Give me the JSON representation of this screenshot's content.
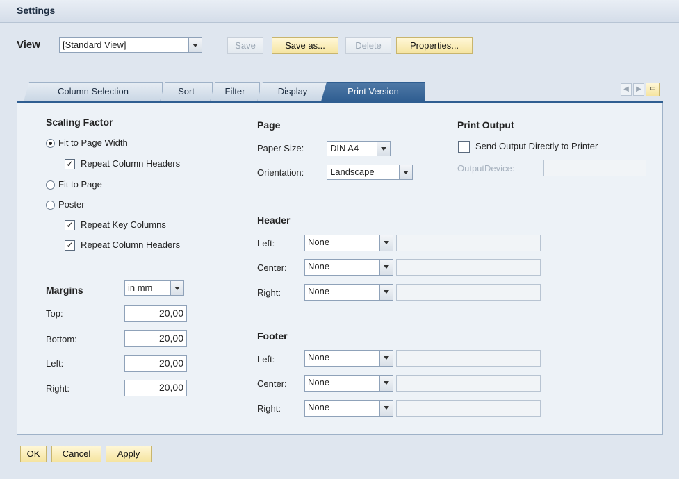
{
  "window": {
    "title": "Settings"
  },
  "view": {
    "label": "View",
    "selected": "[Standard View]",
    "buttons": {
      "save": "Save",
      "save_as": "Save as...",
      "delete": "Delete",
      "properties": "Properties..."
    }
  },
  "tabs": [
    "Column Selection",
    "Sort",
    "Filter",
    "Display",
    "Print Version"
  ],
  "active_tab": "Print Version",
  "scaling": {
    "title": "Scaling Factor",
    "fit_width": "Fit to Page Width",
    "repeat_col_headers_1": "Repeat Column Headers",
    "fit_page": "Fit to Page",
    "poster": "Poster",
    "repeat_key_cols": "Repeat Key Columns",
    "repeat_col_headers_2": "Repeat Column Headers"
  },
  "margins": {
    "title": "Margins",
    "unit": "in mm",
    "top_label": "Top:",
    "top": "20,00",
    "bottom_label": "Bottom:",
    "bottom": "20,00",
    "left_label": "Left:",
    "left": "20,00",
    "right_label": "Right:",
    "right": "20,00"
  },
  "page": {
    "title": "Page",
    "paper_label": "Paper Size:",
    "paper": "DIN A4",
    "orientation_label": "Orientation:",
    "orientation": "Landscape"
  },
  "print_output": {
    "title": "Print Output",
    "send_direct": "Send Output Directly to Printer",
    "device_label": "OutputDevice:"
  },
  "header": {
    "title": "Header",
    "left_label": "Left:",
    "left": "None",
    "center_label": "Center:",
    "center": "None",
    "right_label": "Right:",
    "right": "None"
  },
  "footer": {
    "title": "Footer",
    "left_label": "Left:",
    "left": "None",
    "center_label": "Center:",
    "center": "None",
    "right_label": "Right:",
    "right": "None"
  },
  "bottom_buttons": {
    "ok": "OK",
    "cancel": "Cancel",
    "apply": "Apply"
  },
  "colors": {
    "accent": "#2f5e91",
    "button": "#f5e4a0",
    "background": "#dfe6ef"
  }
}
